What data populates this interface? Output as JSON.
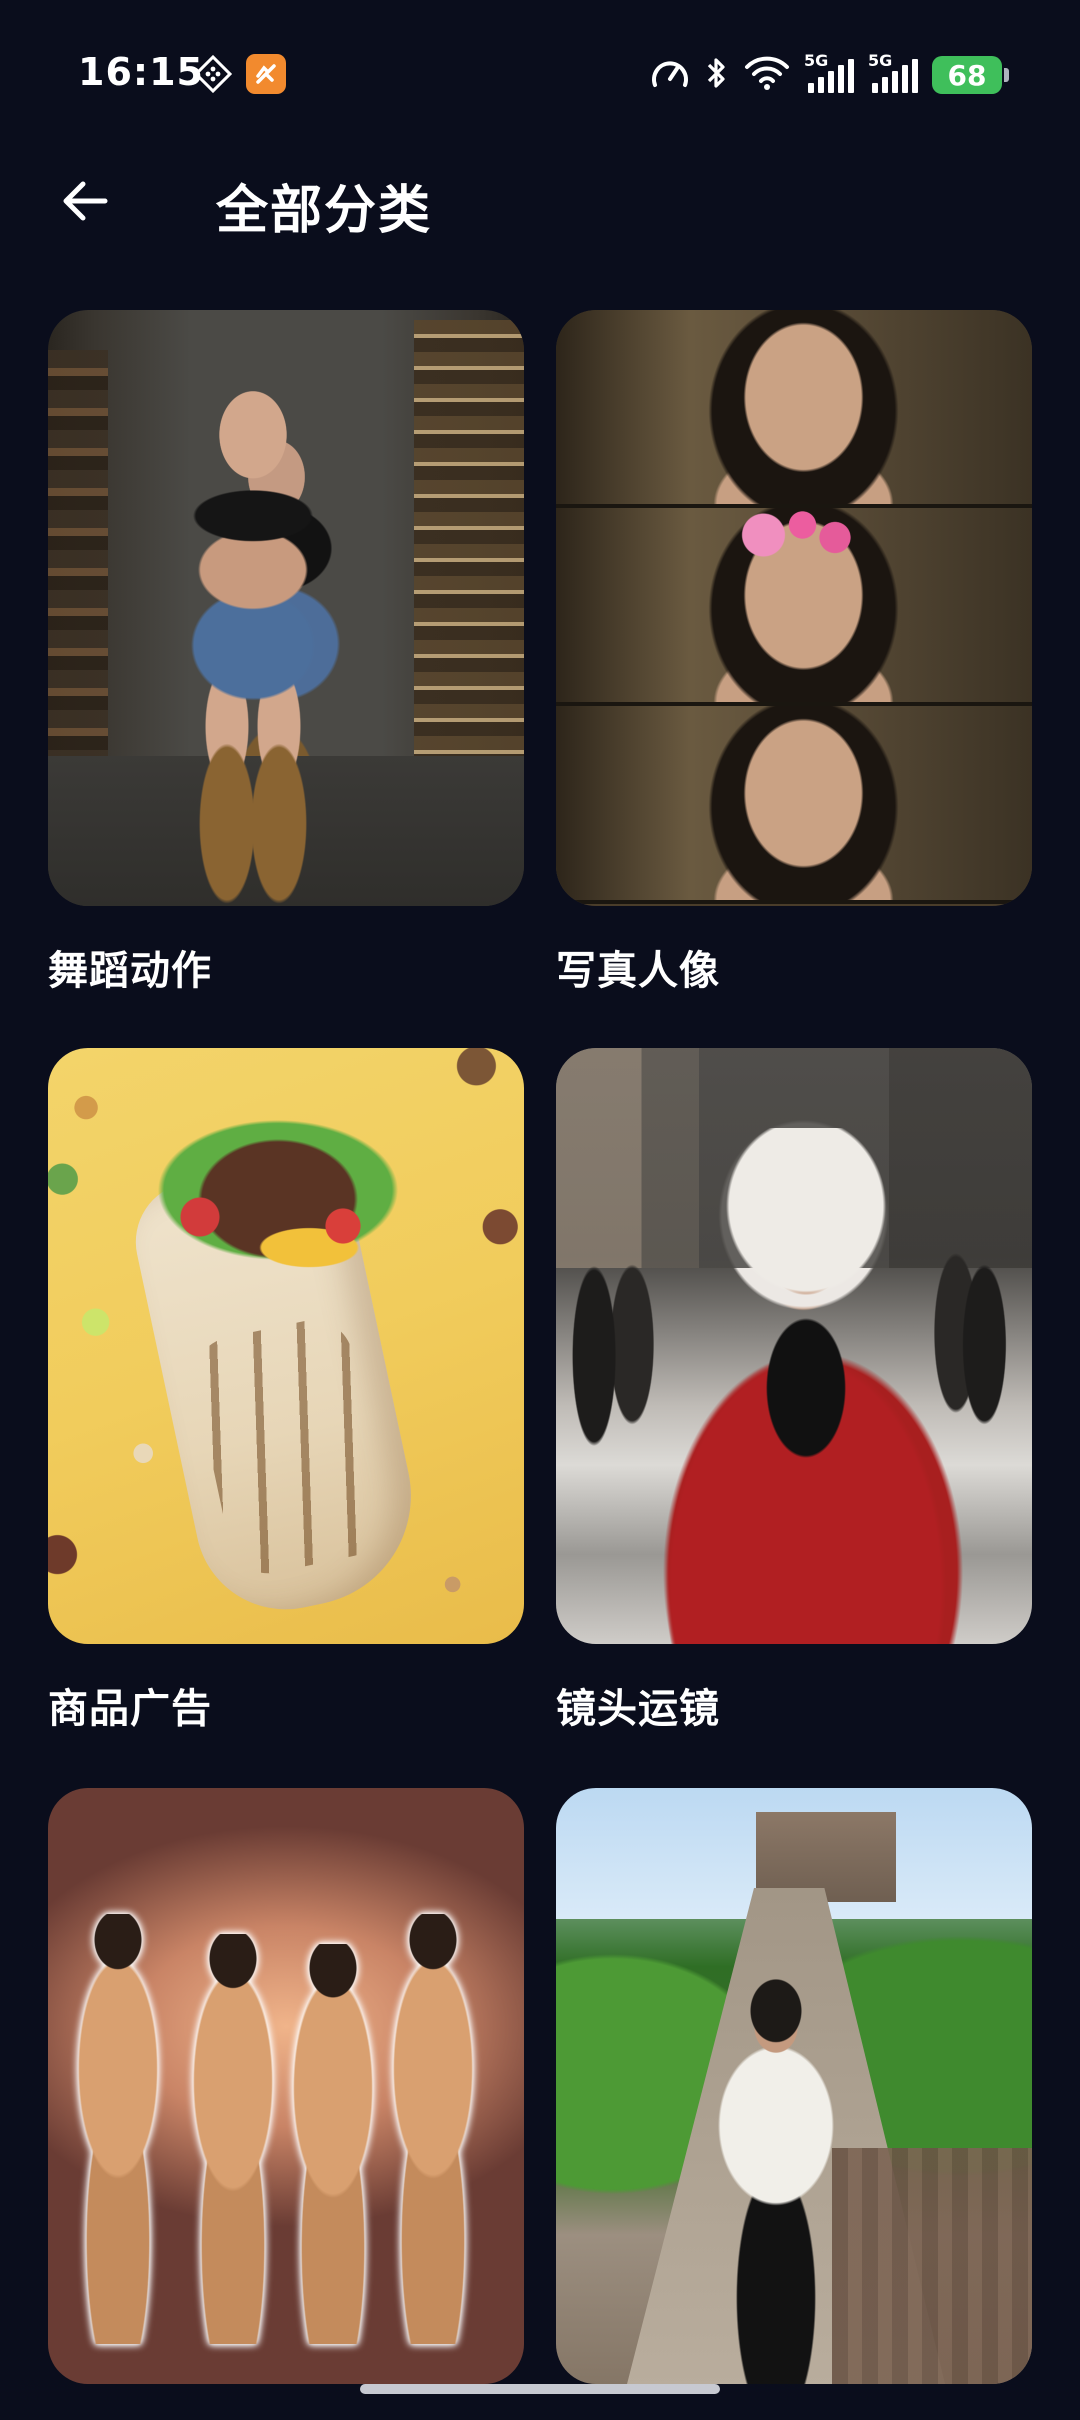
{
  "status_bar": {
    "time": "16:15",
    "network_1": "5G",
    "network_2": "5G",
    "battery": "68"
  },
  "header": {
    "title": "全部分类"
  },
  "categories": [
    {
      "label": "舞蹈动作"
    },
    {
      "label": "写真人像"
    },
    {
      "label": "商品广告"
    },
    {
      "label": "镜头运镜"
    },
    {
      "label": ""
    },
    {
      "label": ""
    }
  ]
}
